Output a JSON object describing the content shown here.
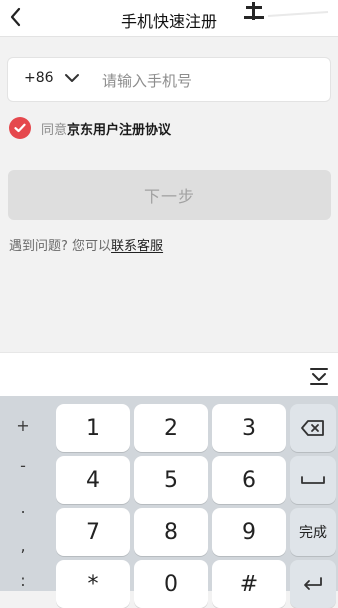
{
  "header": {
    "title": "手机快速注册"
  },
  "form": {
    "country_code": "+86",
    "phone_placeholder": "请输入手机号",
    "agree_prefix": "同意",
    "agreement_link": "京东用户注册协议",
    "next_button": "下一步"
  },
  "help": {
    "text": "遇到问题? 您可以",
    "link": "联系客服"
  },
  "keyboard": {
    "side_symbols": [
      "+",
      "-",
      ".",
      ",",
      ":"
    ],
    "rows": [
      [
        "1",
        "2",
        "3"
      ],
      [
        "4",
        "5",
        "6"
      ],
      [
        "7",
        "8",
        "9"
      ],
      [
        "*",
        "0",
        "#"
      ]
    ],
    "done_label": "完成"
  }
}
